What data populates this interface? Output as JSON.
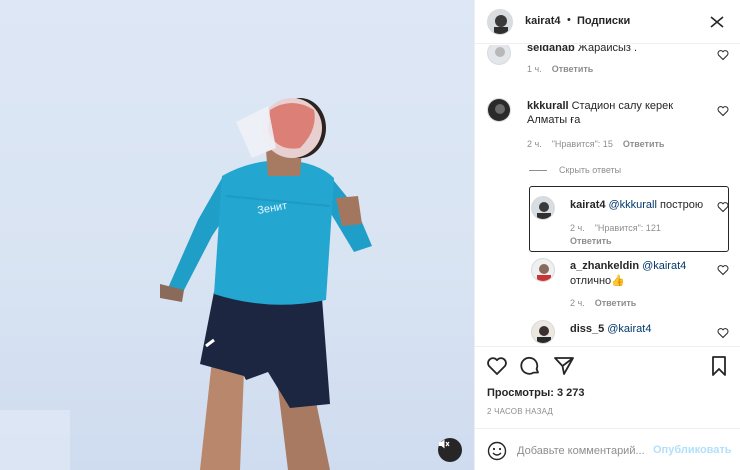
{
  "header": {
    "username": "kairat4",
    "separator": "•",
    "follow_label": "Подписки"
  },
  "comments": [
    {
      "user": "seldanab",
      "text": "Жарайсыз .",
      "time": "1 ч.",
      "likes": "",
      "reply": "Ответить"
    },
    {
      "user": "kkkurall",
      "text": "Стадион салу керек Алматы ға",
      "time": "2 ч.",
      "likes": "\"Нравится\": 15",
      "reply": "Ответить"
    }
  ],
  "hide_replies": "Скрыть ответы",
  "replies": [
    {
      "user": "kairat4",
      "mention": "@kkkurall",
      "text": "построю",
      "time": "2 ч.",
      "likes": "\"Нравится\": 121",
      "reply": "Ответить"
    },
    {
      "user": "a_zhankeldin",
      "mention": "@kairat4",
      "text": "отлично👍",
      "time": "2 ч.",
      "reply": "Ответить"
    },
    {
      "user": "diss_5",
      "mention": "@kairat4",
      "text": ""
    }
  ],
  "stats": {
    "views": "Просмотры: 3 273",
    "posted": "2 ЧАСОВ НАЗАД"
  },
  "composer": {
    "placeholder": "Добавьте комментарий...",
    "publish_label": "Опубликовать"
  },
  "icons": [
    "heart-icon",
    "comment-icon",
    "share-icon",
    "bookmark-icon",
    "more-icon",
    "emoji-icon",
    "mute-icon"
  ]
}
